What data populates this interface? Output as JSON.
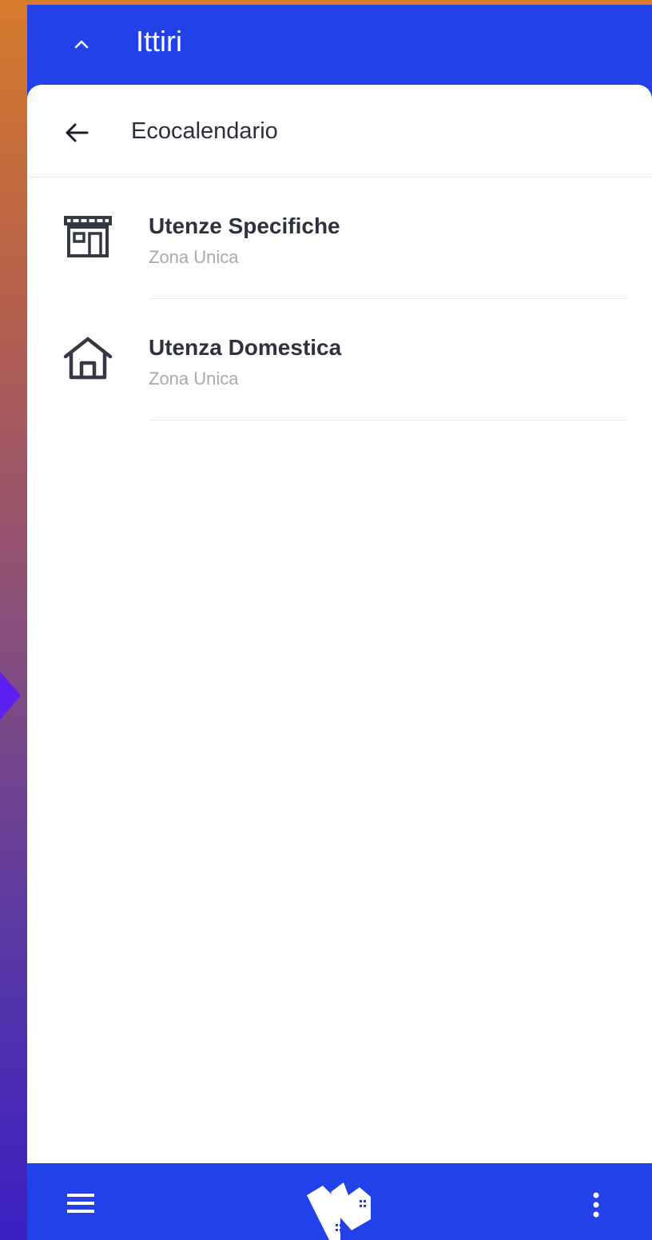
{
  "header": {
    "title": "Ittiri"
  },
  "subheader": {
    "title": "Ecocalendario"
  },
  "list": {
    "items": [
      {
        "title": "Utenze Specifiche",
        "subtitle": "Zona Unica",
        "icon": "store-icon"
      },
      {
        "title": "Utenza Domestica",
        "subtitle": "Zona Unica",
        "icon": "home-icon"
      }
    ]
  },
  "colors": {
    "primary": "#2241e8",
    "card": "#ffffff",
    "text_primary": "#2d3140",
    "text_secondary": "#a7a9b2"
  },
  "bottom_bar": {
    "menu_icon": "menu-icon",
    "logo": "app-logo",
    "more_icon": "more-vert-icon"
  }
}
